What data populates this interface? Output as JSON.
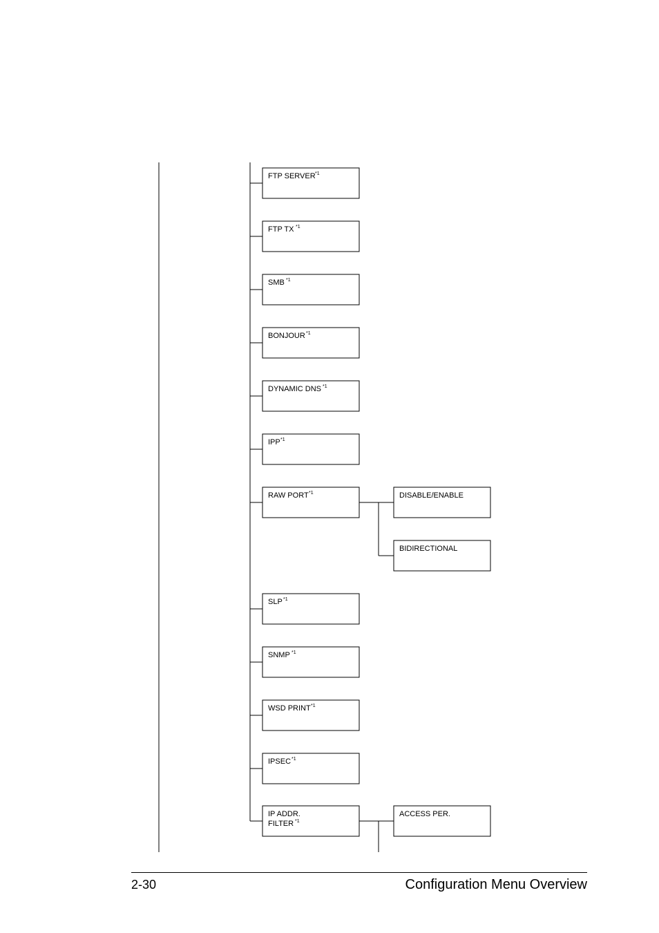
{
  "tree": {
    "items": [
      {
        "label": "FTP SERVER",
        "sup": "*1"
      },
      {
        "label": "FTP TX",
        "sup": "*1"
      },
      {
        "label": "SMB",
        "sup": "*1"
      },
      {
        "label": "BONJOUR",
        "sup": "*1"
      },
      {
        "label": "DYNAMIC DNS",
        "sup": "*1"
      },
      {
        "label": "IPP",
        "sup": "*1"
      },
      {
        "label": "RAW PORT",
        "sup": "*1"
      },
      {
        "label": "SLP",
        "sup": "*1"
      },
      {
        "label": "SNMP",
        "sup": "*1"
      },
      {
        "label": "WSD PRINT",
        "sup": "*1"
      },
      {
        "label": "IPSEC",
        "sup": "*1"
      },
      {
        "label_line1": "IP ADDR.",
        "label_line2": "FILTER",
        "sup": "*1"
      }
    ],
    "rawport_children": [
      "DISABLE/ENABLE",
      "BIDIRECTIONAL"
    ],
    "ipfilter_children": [
      "ACCESS PER."
    ]
  },
  "footer": {
    "page_number": "2-30",
    "title": "Configuration Menu Overview"
  }
}
